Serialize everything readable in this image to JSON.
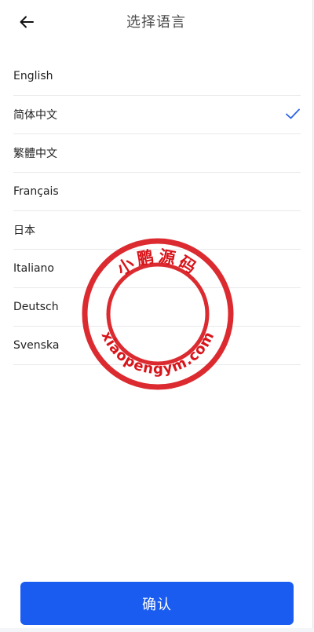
{
  "header": {
    "back_icon": "arrow-left-icon",
    "title": "选择语言"
  },
  "languages": [
    {
      "label": "English",
      "selected": false
    },
    {
      "label": "简体中文",
      "selected": true
    },
    {
      "label": "繁體中文",
      "selected": false
    },
    {
      "label": "Français",
      "selected": false
    },
    {
      "label": "日本",
      "selected": false
    },
    {
      "label": "Italiano",
      "selected": false
    },
    {
      "label": "Deutsch",
      "selected": false
    },
    {
      "label": "Svenska",
      "selected": false
    }
  ],
  "selected_icon": "checkmark-icon",
  "watermark": {
    "top_text": "小鹏源码",
    "bottom_text": "xiaopengym.com",
    "color": "#d8141a"
  },
  "confirm_label": "确认",
  "colors": {
    "accent": "#1a5bf0",
    "check": "#2a62e8"
  }
}
